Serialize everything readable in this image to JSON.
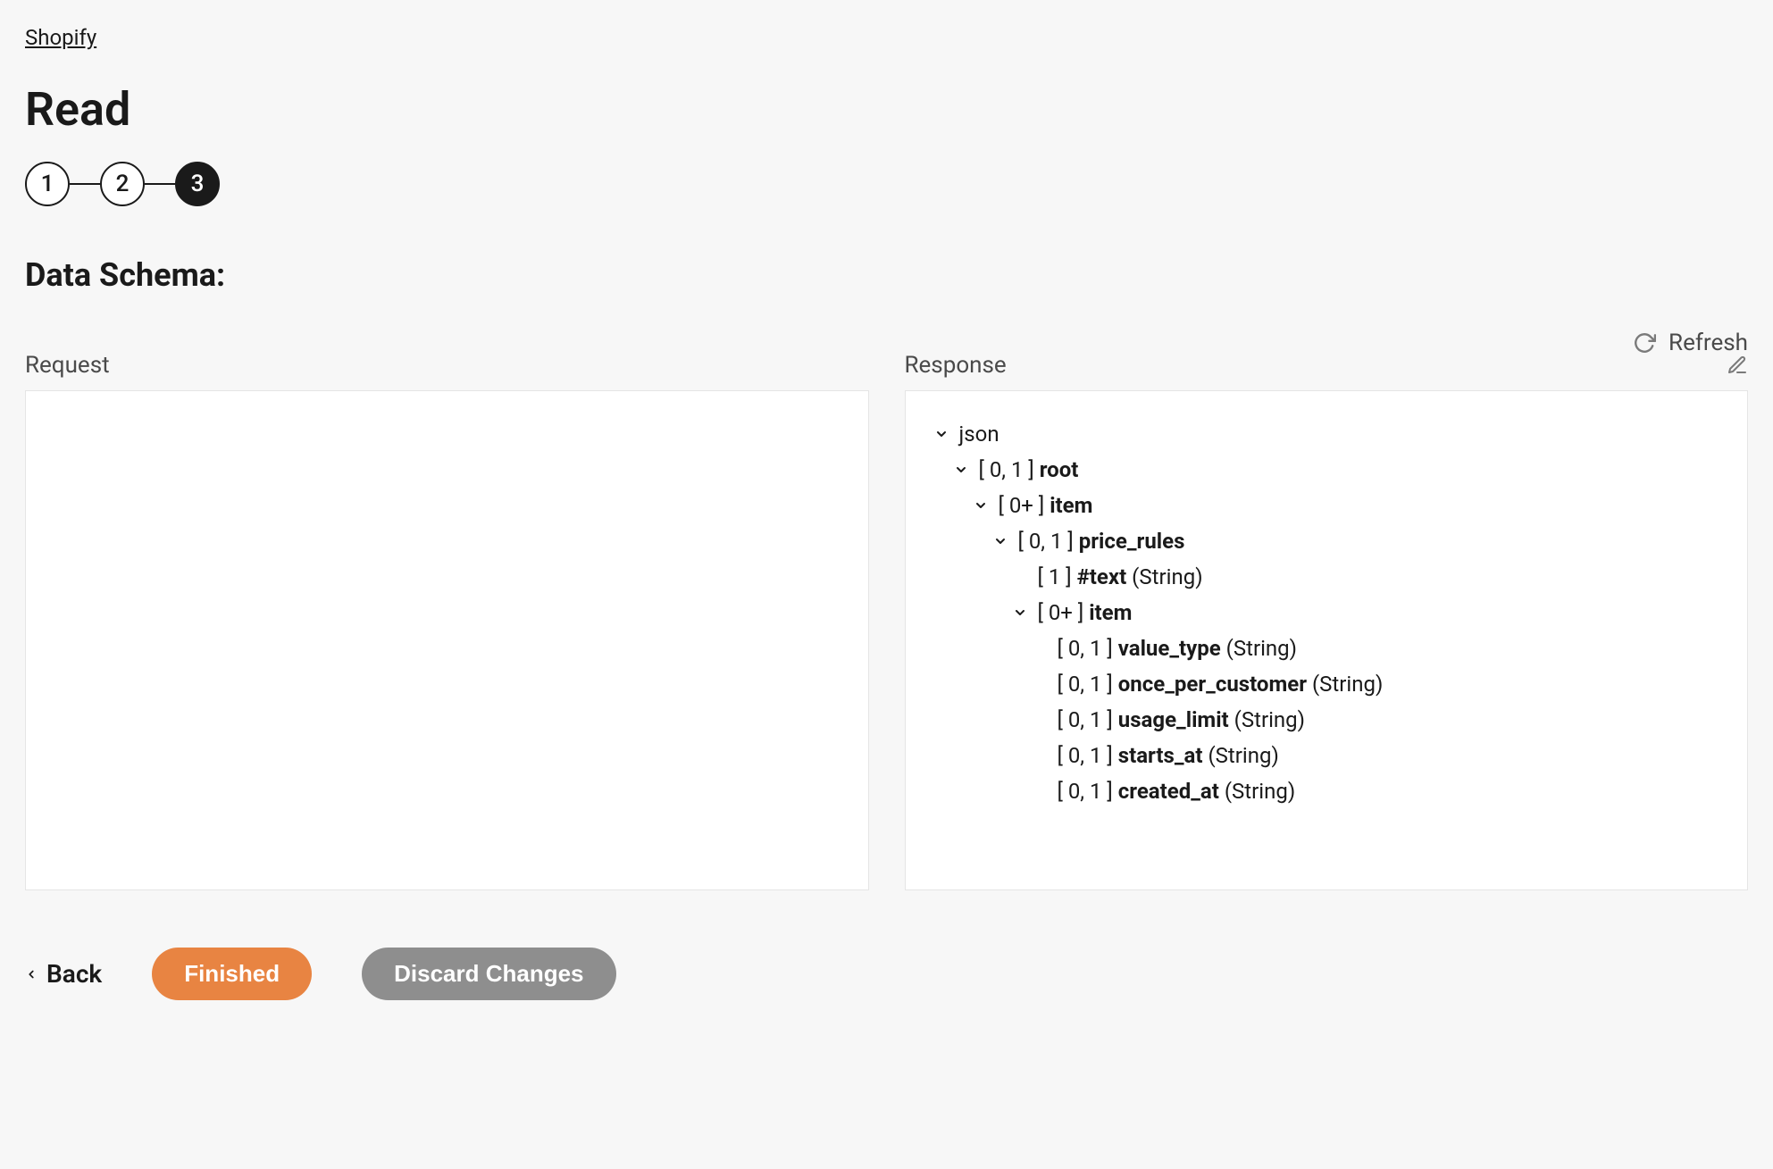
{
  "breadcrumb": "Shopify",
  "page_title": "Read",
  "stepper": {
    "steps": [
      "1",
      "2",
      "3"
    ],
    "active_index": 2
  },
  "section_title": "Data Schema:",
  "refresh_label": "Refresh",
  "request_label": "Request",
  "response_label": "Response",
  "response_tree": {
    "root": {
      "label": "json",
      "children": [
        {
          "cardinality": "[ 0, 1 ]",
          "name": "root",
          "children": [
            {
              "cardinality": "[ 0+ ]",
              "name": "item",
              "children": [
                {
                  "cardinality": "[ 0, 1 ]",
                  "name": "price_rules",
                  "children": [
                    {
                      "cardinality": "[ 1 ]",
                      "name": "#text",
                      "type": "(String)"
                    },
                    {
                      "cardinality": "[ 0+ ]",
                      "name": "item",
                      "children": [
                        {
                          "cardinality": "[ 0, 1 ]",
                          "name": "value_type",
                          "type": "(String)"
                        },
                        {
                          "cardinality": "[ 0, 1 ]",
                          "name": "once_per_customer",
                          "type": "(String)"
                        },
                        {
                          "cardinality": "[ 0, 1 ]",
                          "name": "usage_limit",
                          "type": "(String)"
                        },
                        {
                          "cardinality": "[ 0, 1 ]",
                          "name": "starts_at",
                          "type": "(String)"
                        },
                        {
                          "cardinality": "[ 0, 1 ]",
                          "name": "created_at",
                          "type": "(String)"
                        }
                      ]
                    }
                  ]
                }
              ]
            }
          ]
        }
      ]
    }
  },
  "footer": {
    "back": "Back",
    "finished": "Finished",
    "discard": "Discard Changes"
  }
}
